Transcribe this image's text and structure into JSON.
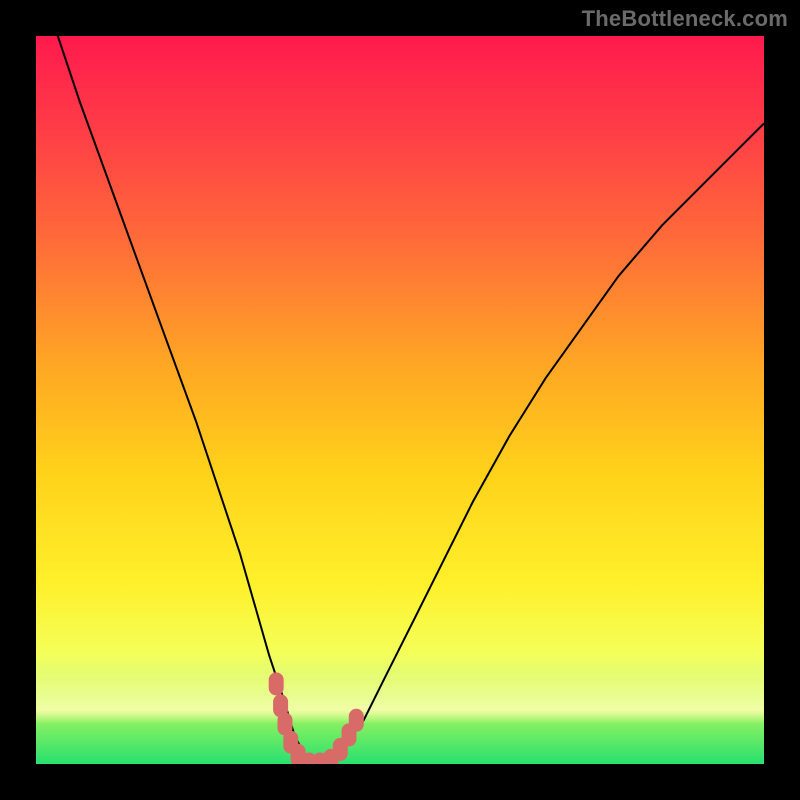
{
  "watermark": "TheBottleneck.com",
  "colors": {
    "gradient_top": "#ff1a4d",
    "gradient_bottom": "#28e070",
    "curve_stroke": "#000000",
    "marker_fill": "#d86b68",
    "frame_bg": "#000000"
  },
  "chart_data": {
    "type": "line",
    "title": "",
    "xlabel": "",
    "ylabel": "",
    "xlim": [
      0,
      100
    ],
    "ylim": [
      0,
      100
    ],
    "grid": false,
    "legend": false,
    "series": [
      {
        "name": "bottleneck-curve",
        "x": [
          3,
          6,
          10,
          14,
          18,
          22,
          25,
          28,
          30,
          32,
          34,
          35.5,
          37.5,
          40,
          42,
          45,
          48,
          52,
          56,
          60,
          65,
          70,
          75,
          80,
          86,
          92,
          100
        ],
        "values": [
          100,
          91,
          80,
          69,
          58,
          47,
          38,
          29,
          22,
          15,
          9,
          4,
          0,
          0,
          2,
          6,
          12,
          20,
          28,
          36,
          45,
          53,
          60,
          67,
          74,
          80,
          88
        ]
      }
    ],
    "markers": [
      {
        "x": 33.0,
        "y": 11
      },
      {
        "x": 33.6,
        "y": 8
      },
      {
        "x": 34.2,
        "y": 5.5
      },
      {
        "x": 35.0,
        "y": 3
      },
      {
        "x": 36.0,
        "y": 1.2
      },
      {
        "x": 37.5,
        "y": 0
      },
      {
        "x": 39.0,
        "y": 0
      },
      {
        "x": 40.5,
        "y": 0.5
      },
      {
        "x": 41.8,
        "y": 2
      },
      {
        "x": 43.0,
        "y": 4
      },
      {
        "x": 44.0,
        "y": 6
      }
    ],
    "annotations": []
  }
}
